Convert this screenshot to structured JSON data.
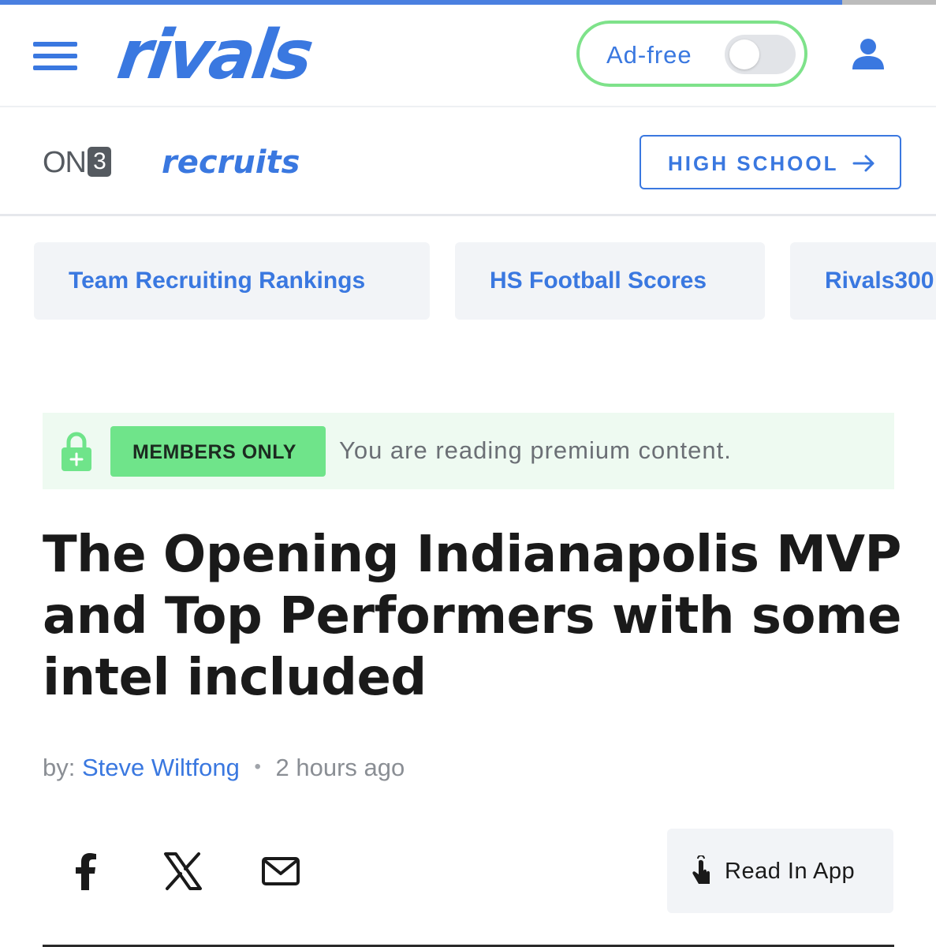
{
  "header": {
    "logo_text": "rivals",
    "adfree_label": "Ad-free",
    "adfree_enabled": false,
    "reading_progress": 0.9
  },
  "subheader": {
    "on3_text": "ON",
    "on3_digit": "3",
    "section_logo": "recruits",
    "high_school_label": "HIGH SCHOOL"
  },
  "nav_chips": [
    {
      "label": "Team Recruiting Rankings"
    },
    {
      "label": "HS Football Scores"
    },
    {
      "label": "Rivals300"
    }
  ],
  "members_banner": {
    "badge": "MEMBERS ONLY",
    "text": "You are reading premium content."
  },
  "article": {
    "headline": "The Opening Indianapolis MVP and Top Performers with some intel included",
    "by_prefix": "by:",
    "author": "Steve Wiltfong",
    "time_ago": "2 hours ago"
  },
  "share": {
    "icons": [
      "facebook-icon",
      "x-icon",
      "mail-icon"
    ],
    "read_in_app_label": "Read In App"
  },
  "colors": {
    "brand_blue": "#3a78e0",
    "members_green": "#6fe48a",
    "toggle_outline": "#7ee28a"
  }
}
